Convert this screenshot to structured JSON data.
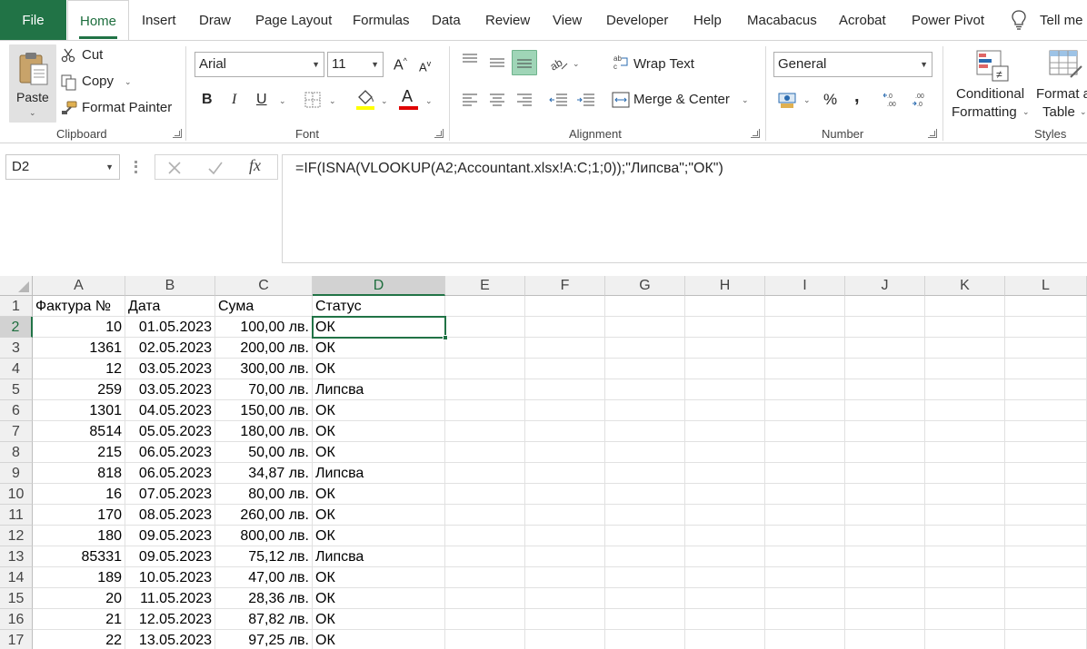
{
  "tabs": [
    "File",
    "Home",
    "Insert",
    "Draw",
    "Page Layout",
    "Formulas",
    "Data",
    "Review",
    "View",
    "Developer",
    "Help",
    "Macabacus",
    "Acrobat",
    "Power Pivot",
    "Tell me"
  ],
  "active_tab": "Home",
  "clipboard": {
    "paste_label": "Paste",
    "cut_label": "Cut",
    "copy_label": "Copy",
    "format_painter_label": "Format Painter",
    "group_label": "Clipboard"
  },
  "font": {
    "font_name": "Arial",
    "font_size": "11",
    "bold": "B",
    "italic": "I",
    "underline": "U",
    "grow": "A",
    "shrink": "A",
    "font_color_glyph": "A",
    "highlight_color": "#ffff00",
    "font_color": "#e00000",
    "group_label": "Font"
  },
  "alignment": {
    "wrap_text_label": "Wrap Text",
    "merge_center_label": "Merge & Center",
    "group_label": "Alignment"
  },
  "number": {
    "format": "General",
    "percent": "%",
    "comma": ",",
    "group_label": "Number"
  },
  "styles": {
    "conditional_label_1": "Conditional",
    "conditional_label_2": "Formatting",
    "format_table_label_1": "Format as",
    "format_table_label_2": "Table",
    "group_label": "Styles"
  },
  "formula_bar": {
    "name_box": "D2",
    "formula": "=IF(ISNA(VLOOKUP(A2;Accountant.xlsx!A:C;1;0));\"Липсва\";\"ОК\")",
    "fx": "fx"
  },
  "sheet": {
    "columns": [
      "A",
      "B",
      "C",
      "D",
      "E",
      "F",
      "G",
      "H",
      "I",
      "J",
      "K",
      "L"
    ],
    "selected_column": "D",
    "selected_row": "2",
    "header_row": [
      "Фактура №",
      "Дата",
      "Сума",
      "Статус"
    ],
    "rows": [
      {
        "n": "2",
        "a": "10",
        "b": "01.05.2023",
        "c": "100,00 лв.",
        "d": "ОК"
      },
      {
        "n": "3",
        "a": "1361",
        "b": "02.05.2023",
        "c": "200,00 лв.",
        "d": "ОК"
      },
      {
        "n": "4",
        "a": "12",
        "b": "03.05.2023",
        "c": "300,00 лв.",
        "d": "ОК"
      },
      {
        "n": "5",
        "a": "259",
        "b": "03.05.2023",
        "c": "70,00 лв.",
        "d": "Липсва"
      },
      {
        "n": "6",
        "a": "1301",
        "b": "04.05.2023",
        "c": "150,00 лв.",
        "d": "ОК"
      },
      {
        "n": "7",
        "a": "8514",
        "b": "05.05.2023",
        "c": "180,00 лв.",
        "d": "ОК"
      },
      {
        "n": "8",
        "a": "215",
        "b": "06.05.2023",
        "c": "50,00 лв.",
        "d": "ОК"
      },
      {
        "n": "9",
        "a": "818",
        "b": "06.05.2023",
        "c": "34,87 лв.",
        "d": "Липсва"
      },
      {
        "n": "10",
        "a": "16",
        "b": "07.05.2023",
        "c": "80,00 лв.",
        "d": "ОК"
      },
      {
        "n": "11",
        "a": "170",
        "b": "08.05.2023",
        "c": "260,00 лв.",
        "d": "ОК"
      },
      {
        "n": "12",
        "a": "180",
        "b": "09.05.2023",
        "c": "800,00 лв.",
        "d": "ОК"
      },
      {
        "n": "13",
        "a": "85331",
        "b": "09.05.2023",
        "c": "75,12 лв.",
        "d": "Липсва"
      },
      {
        "n": "14",
        "a": "189",
        "b": "10.05.2023",
        "c": "47,00 лв.",
        "d": "ОК"
      },
      {
        "n": "15",
        "a": "20",
        "b": "11.05.2023",
        "c": "28,36 лв.",
        "d": "ОК"
      },
      {
        "n": "16",
        "a": "21",
        "b": "12.05.2023",
        "c": "87,82 лв.",
        "d": "ОК"
      },
      {
        "n": "17",
        "a": "22",
        "b": "13.05.2023",
        "c": "97,25 лв.",
        "d": "ОК"
      }
    ]
  },
  "colors": {
    "excel_green": "#217346",
    "header_gray": "#f0f0f0",
    "selected_header": "#d2d2d2"
  }
}
